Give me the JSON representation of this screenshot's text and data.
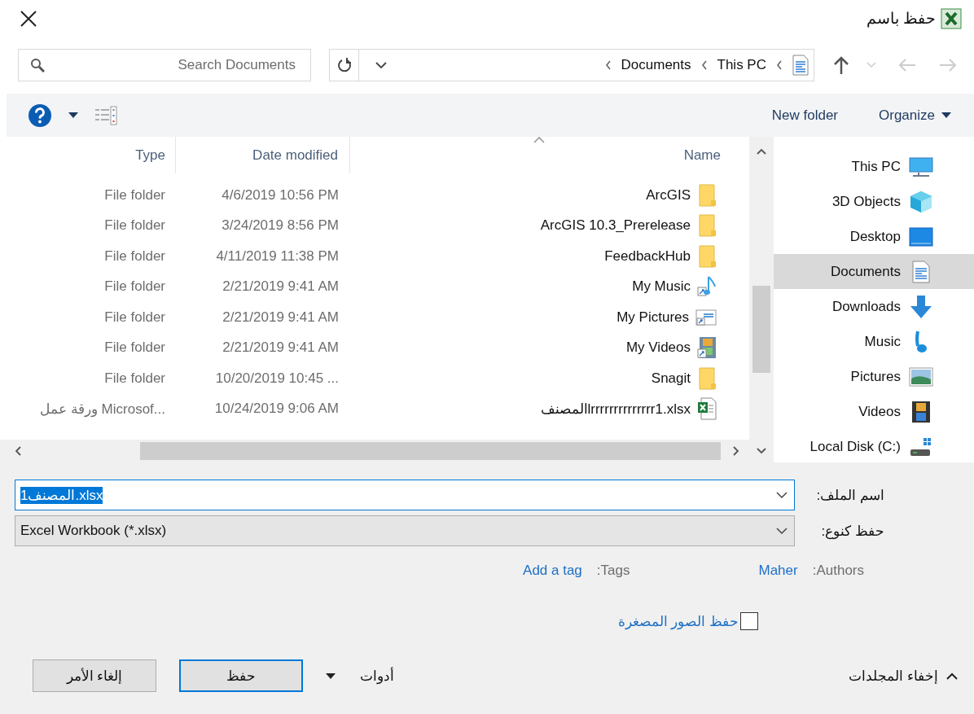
{
  "window": {
    "title": "حفظ باسم"
  },
  "search": {
    "placeholder": "Search Documents"
  },
  "address": {
    "path": [
      "Documents",
      "This PC"
    ]
  },
  "toolbar": {
    "organize": "Organize",
    "new_folder": "New folder"
  },
  "columns": [
    "Type",
    "Date modified",
    "Name"
  ],
  "files": [
    {
      "name": "ArcGIS",
      "date_modified": "4/6/2019 10:56 PM",
      "type": "File folder",
      "kind": "folder"
    },
    {
      "name": "ArcGIS 10.3_Prerelease",
      "date_modified": "3/24/2019 8:56 PM",
      "type": "File folder",
      "kind": "folder"
    },
    {
      "name": "FeedbackHub",
      "date_modified": "4/11/2019 11:38 PM",
      "type": "File folder",
      "kind": "folder"
    },
    {
      "name": "My Music",
      "date_modified": "2/21/2019 9:41 AM",
      "type": "File folder",
      "kind": "music"
    },
    {
      "name": "My Pictures",
      "date_modified": "2/21/2019 9:41 AM",
      "type": "File folder",
      "kind": "pictures"
    },
    {
      "name": "My Videos",
      "date_modified": "2/21/2019 9:41 AM",
      "type": "File folder",
      "kind": "videos"
    },
    {
      "name": "Snagit",
      "date_modified": "10/20/2019 10:45 ...",
      "type": "File folder",
      "kind": "folder"
    },
    {
      "name": "المصنفlrrrrrrrrrrrrrr1.xlsx",
      "date_modified": "10/24/2019 9:06 AM",
      "type": "ورقة عمل Microsof...",
      "kind": "excel"
    }
  ],
  "nav": [
    {
      "label": "This PC",
      "kind": "pc",
      "selected": false
    },
    {
      "label": "3D Objects",
      "kind": "objects",
      "selected": false
    },
    {
      "label": "Desktop",
      "kind": "desktop",
      "selected": false
    },
    {
      "label": "Documents",
      "kind": "documents",
      "selected": true
    },
    {
      "label": "Downloads",
      "kind": "downloads",
      "selected": false
    },
    {
      "label": "Music",
      "kind": "music",
      "selected": false
    },
    {
      "label": "Pictures",
      "kind": "pictures",
      "selected": false
    },
    {
      "label": "Videos",
      "kind": "videos",
      "selected": false
    },
    {
      "label": "Local Disk (C:)",
      "kind": "disk",
      "selected": false
    }
  ],
  "filename": {
    "label": "اسم الملف:",
    "value": "المصنف1.xlsx",
    "text_selected": true
  },
  "filetype": {
    "label": "حفظ كنوع:",
    "value": "Excel Workbook (*.xlsx)"
  },
  "authors": {
    "label": "Authors:",
    "value": "Maher"
  },
  "tags": {
    "label": "Tags:",
    "value": "Add a tag"
  },
  "thumbnail": {
    "label": "حفظ الصور المصغرة",
    "checked": false
  },
  "hide_folders": "إخفاء المجلدات",
  "tools": "أدوات",
  "buttons": [
    {
      "label": "حفظ",
      "default": true
    },
    {
      "label": "إلغاء الأمر",
      "default": false
    }
  ]
}
